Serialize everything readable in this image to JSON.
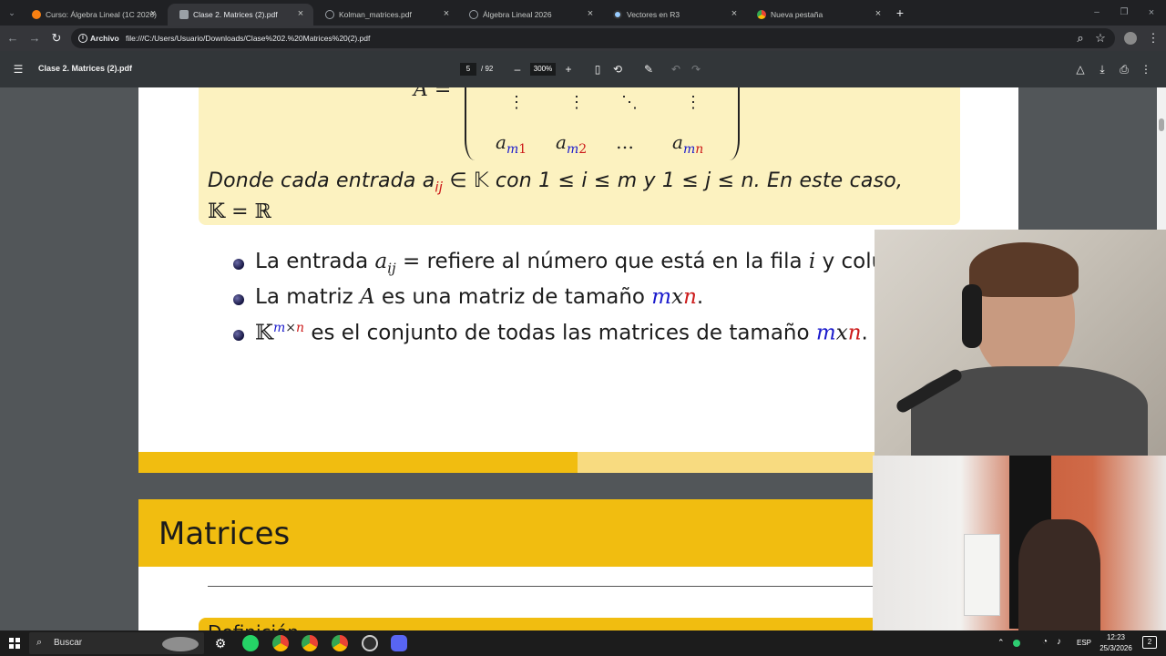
{
  "browser": {
    "tabs": [
      {
        "label": "Curso: Álgebra Lineal (1C 2026)",
        "active": false
      },
      {
        "label": "Clase 2. Matrices (2).pdf",
        "active": true
      },
      {
        "label": "Kolman_matrices.pdf",
        "active": false
      },
      {
        "label": "Álgebra Lineal 2026",
        "active": false
      },
      {
        "label": "Vectores en R3",
        "active": false
      },
      {
        "label": "Nueva pestaña",
        "active": false
      }
    ],
    "new_tab_symbol": "+",
    "omnibox": {
      "chip_label": "Archivo",
      "url": "file:///C:/Users/Usuario/Downloads/Clase%202.%20Matrices%20(2).pdf"
    }
  },
  "pdf_toolbar": {
    "title": "Clase 2. Matrices (2).pdf",
    "page_current": "5",
    "page_total": "/ 92",
    "zoom": "300%",
    "zoom_out": "–",
    "zoom_in": "+"
  },
  "document": {
    "matrix_label": "A =",
    "matrix_bottom_row": [
      {
        "base": "a",
        "sub_row": "m",
        "sub_col": "1"
      },
      {
        "base": "a",
        "sub_row": "m",
        "sub_col": "2"
      },
      {
        "base": "…"
      },
      {
        "base": "a",
        "sub_row": "m",
        "sub_col": "n"
      }
    ],
    "def_line1": {
      "p1": "Donde cada entrada a",
      "sub": "ij",
      "p2": " ∈ 𝕂 con 1 ≤ i ≤ m y 1 ≤ j ≤ n. En este caso,"
    },
    "def_line2": "𝕂 = ℝ",
    "bullets": [
      {
        "p1": "La entrada ",
        "math": "a",
        "sub": "ij",
        "p2": " = ",
        "p3": "refiere al número que está en la fila ",
        "var": "i",
        "p4": " y colu"
      },
      {
        "p1": "La matriz ",
        "var": "A",
        "p2": " es una matriz de tamaño ",
        "m": "m",
        "x": "x",
        "n": "n",
        "end": "."
      },
      {
        "set": "𝕂",
        "sup_m": "m",
        "sup_x": "×",
        "sup_n": "n",
        "p1": " es el conjunto de todas las matrices de tamaño ",
        "m": "m",
        "x": "x",
        "n": "n",
        "end": "."
      }
    ],
    "next_slide_title": "Matrices",
    "next_slide_box_title": "Definición"
  },
  "taskbar": {
    "search_placeholder": "Buscar",
    "language": "ESP",
    "time": "12:23",
    "date": "25/3/2026",
    "notification_count": "2"
  },
  "colors": {
    "accent_yellow": "#f1bd10",
    "def_box": "#fcf2c0",
    "math_blue": "#1a1acc",
    "math_red": "#cc1a1a"
  }
}
